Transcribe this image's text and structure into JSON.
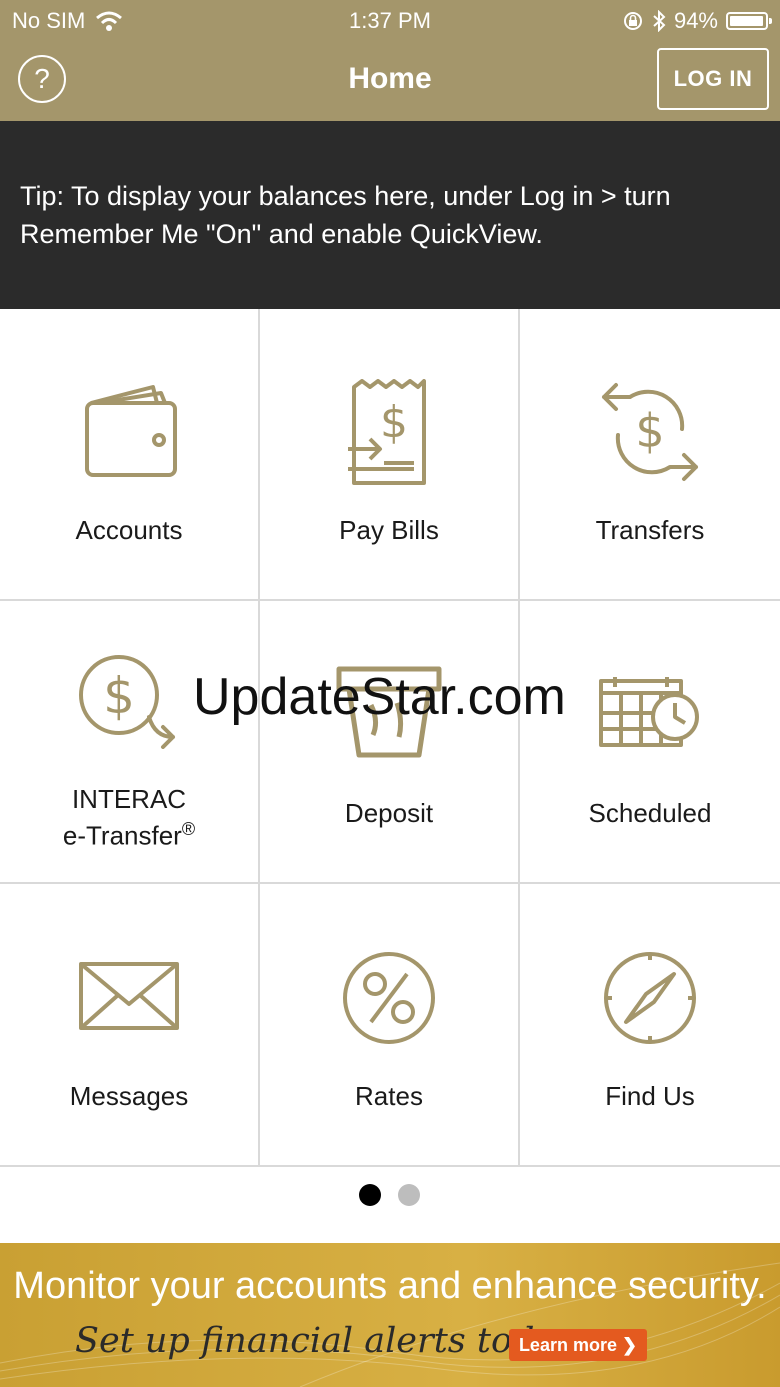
{
  "status_bar": {
    "carrier": "No SIM",
    "time": "1:37 PM",
    "battery": "94%"
  },
  "header": {
    "title": "Home",
    "login_label": "LOG IN",
    "help_glyph": "?"
  },
  "tip": {
    "text": "Tip: To display your balances here, under Log in > turn Remember Me \"On\" and enable QuickView."
  },
  "tiles": [
    {
      "label": "Accounts",
      "icon": "wallet-icon"
    },
    {
      "label": "Pay Bills",
      "icon": "bill-receipt-icon"
    },
    {
      "label": "Transfers",
      "icon": "transfer-arrows-icon"
    },
    {
      "label_line1": "INTERAC",
      "label_line2": "e-Transfer",
      "label_sup": "®",
      "icon": "etransfer-icon"
    },
    {
      "label": "Deposit",
      "icon": "deposit-icon"
    },
    {
      "label": "Scheduled",
      "icon": "calendar-clock-icon"
    },
    {
      "label": "Messages",
      "icon": "envelope-icon"
    },
    {
      "label": "Rates",
      "icon": "percent-icon"
    },
    {
      "label": "Find Us",
      "icon": "compass-icon"
    }
  ],
  "pagination": {
    "pages": 2,
    "current": 1
  },
  "banner": {
    "headline": "Monitor your accounts and enhance security.",
    "subline": "Set up financial alerts today.",
    "cta": "Learn more ❯"
  },
  "watermark": "UpdateStar.com",
  "colors": {
    "gold": "#a4966b",
    "dark": "#2b2b2b",
    "orange": "#e45a1f",
    "banner": "#d8b044"
  }
}
